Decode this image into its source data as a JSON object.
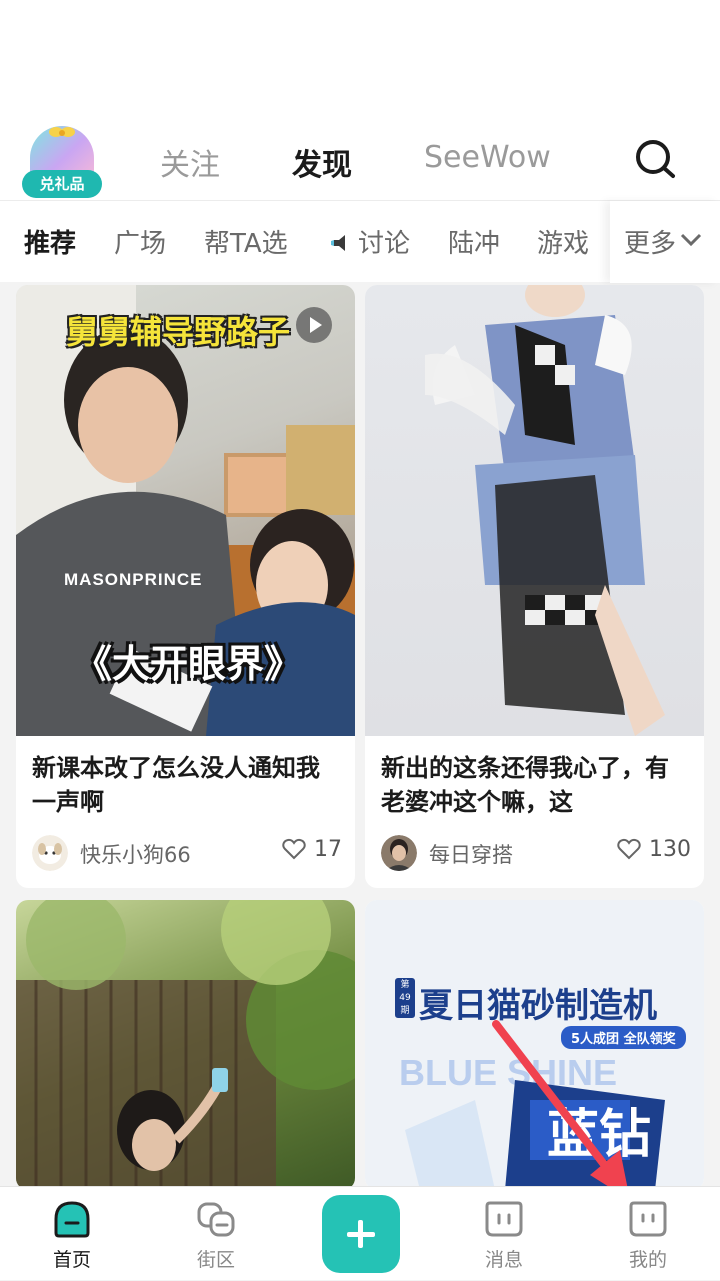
{
  "top_nav": {
    "gift_label": "兑礼品",
    "tabs": [
      {
        "label": "关注",
        "active": false
      },
      {
        "label": "发现",
        "active": true
      },
      {
        "label": "SeeWow",
        "active": false
      }
    ],
    "search_icon": "search-icon"
  },
  "categories": {
    "items": [
      "推荐",
      "广场",
      "帮TA选",
      "讨论",
      "陆冲",
      "游戏"
    ],
    "active": "推荐",
    "more_label": "更多"
  },
  "cards": [
    {
      "overlay_top": "舅舅辅导野路子",
      "overlay_bottom": "《大开眼界》",
      "title": "新课本改了怎么没人通知我一声啊",
      "author": "快乐小狗66",
      "likes": "17",
      "is_video": true
    },
    {
      "title": "新出的这条还得我心了，有老婆冲这个嘛，这",
      "author": "每日穿搭",
      "likes": "130",
      "is_video": false
    },
    {
      "title": "",
      "author": "",
      "likes": ""
    },
    {
      "ad_issue": "第49期",
      "ad_title": "夏日猫砂制造机",
      "ad_sub": "5人成团 全队领奖",
      "ad_brand": "BLUE SHINE",
      "ad_product": "蓝钻"
    }
  ],
  "bottom_nav": [
    {
      "label": "首页",
      "icon": "home-icon",
      "active": true
    },
    {
      "label": "街区",
      "icon": "community-icon",
      "active": false
    },
    {
      "label": "",
      "icon": "plus-icon",
      "active": false
    },
    {
      "label": "消息",
      "icon": "message-icon",
      "active": false
    },
    {
      "label": "我的",
      "icon": "profile-icon",
      "active": false
    }
  ],
  "colors": {
    "accent": "#25c2b5",
    "annotation_arrow": "#f0424f"
  }
}
